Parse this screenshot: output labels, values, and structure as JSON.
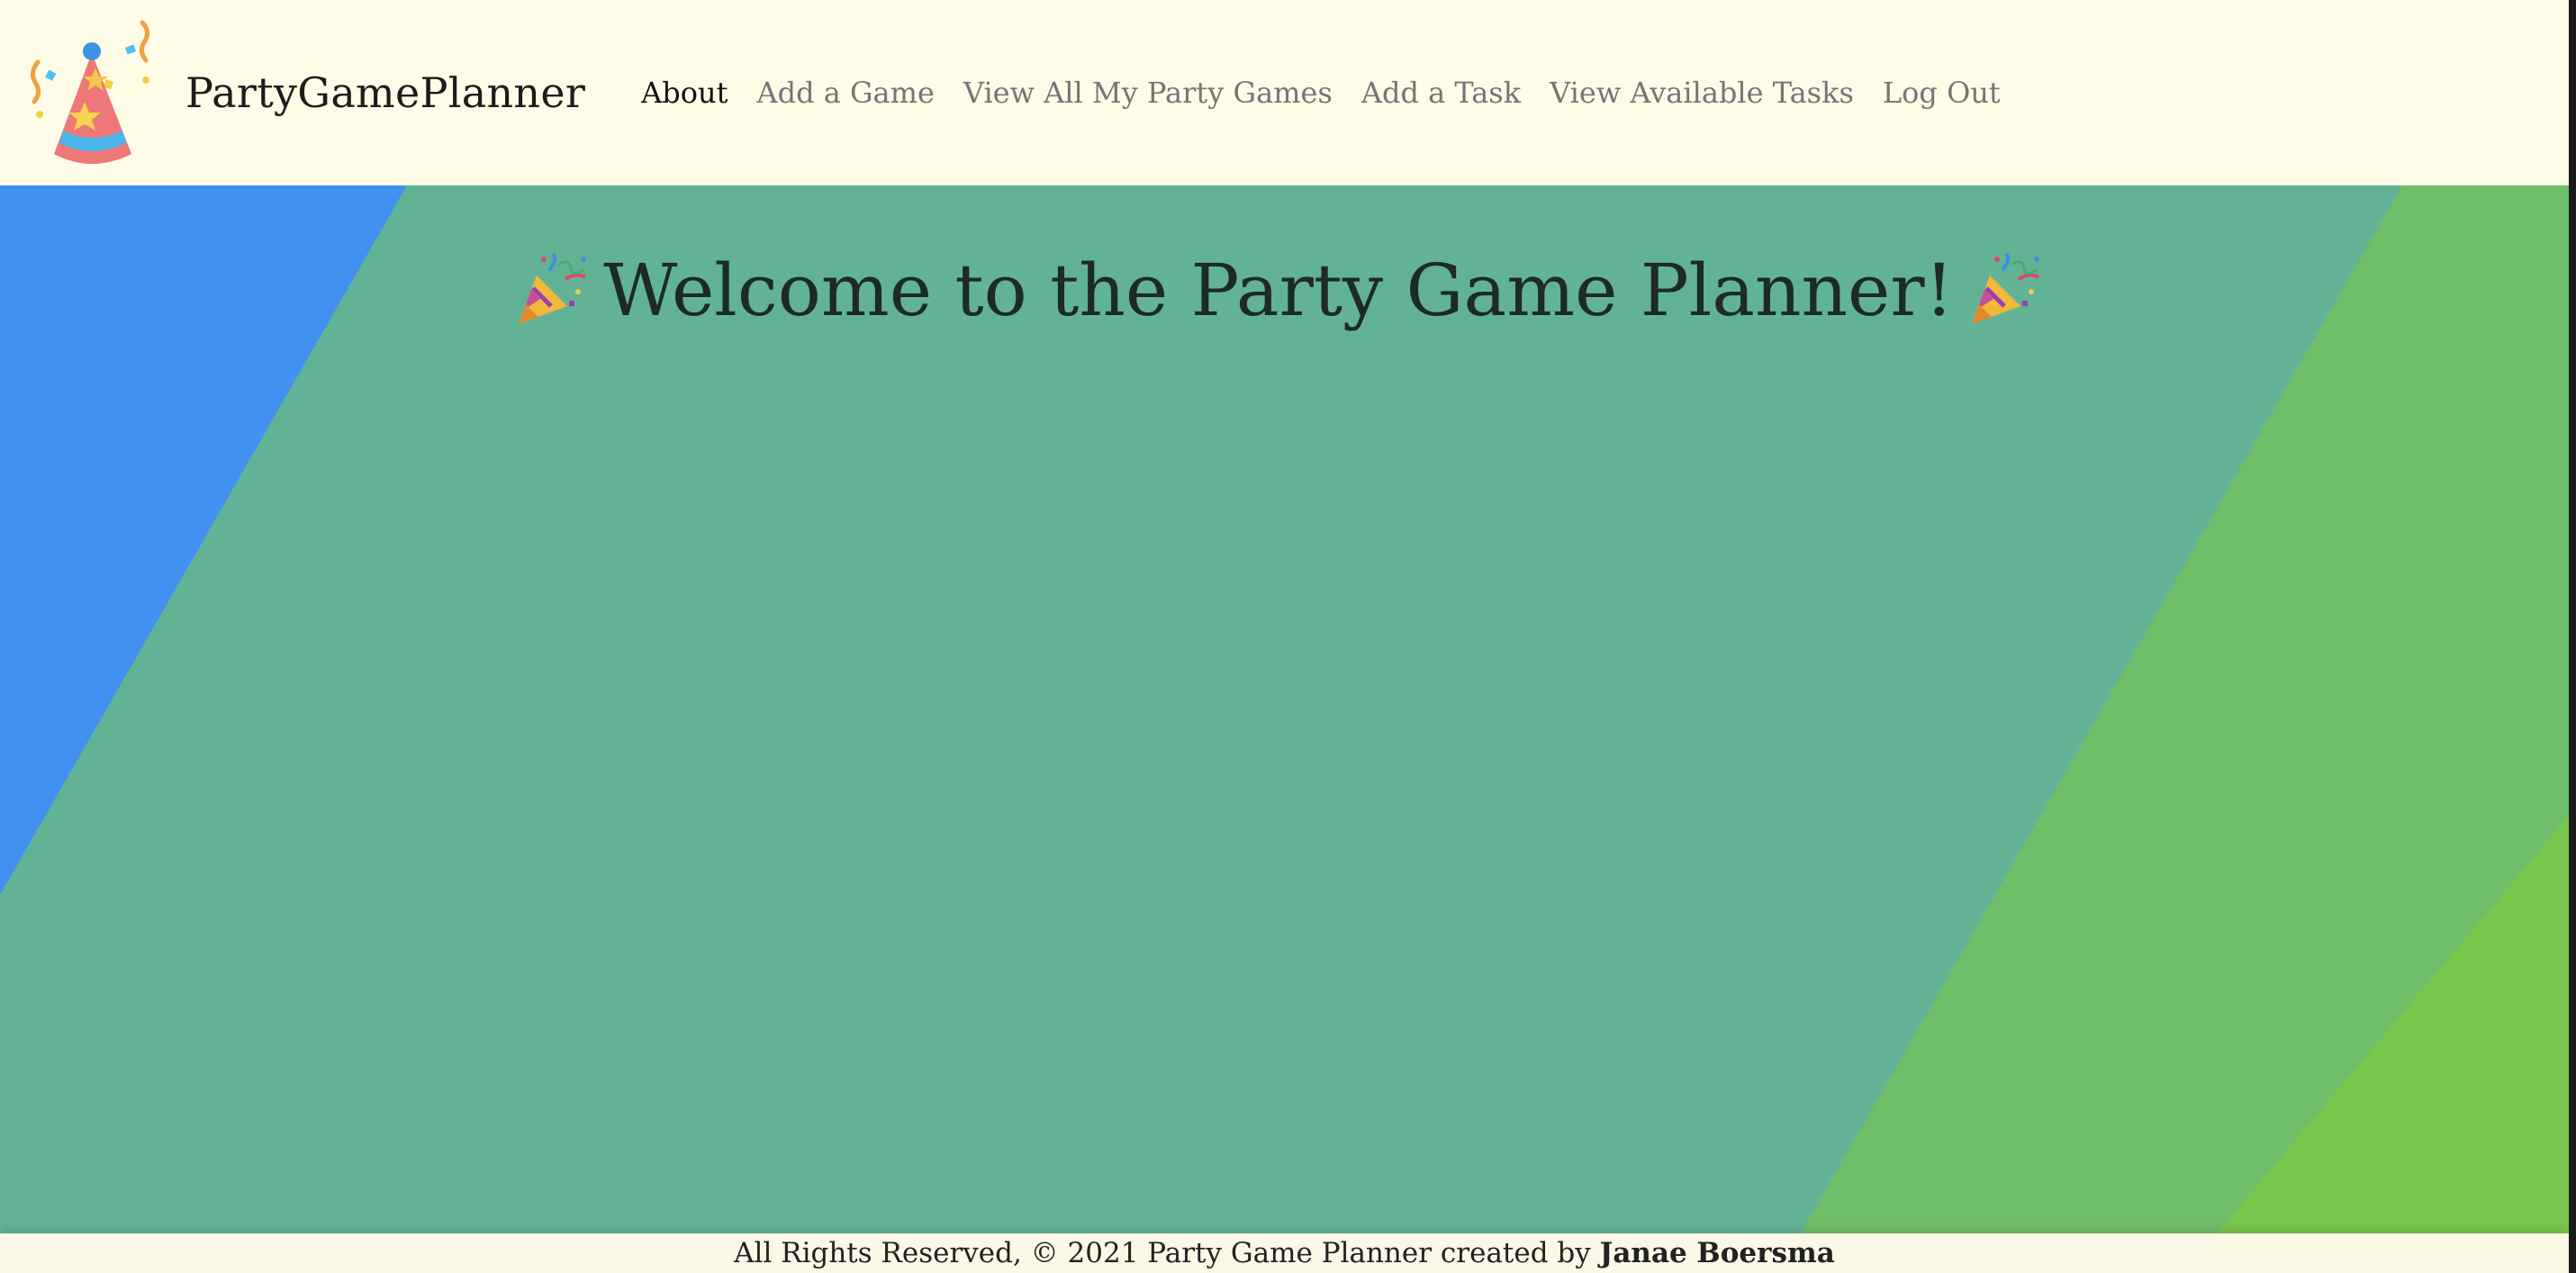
{
  "brand": {
    "name": "PartyGamePlanner",
    "logo_icon": "party-hat-icon"
  },
  "nav": {
    "items": [
      {
        "label": "About",
        "active": true
      },
      {
        "label": "Add a Game",
        "active": false
      },
      {
        "label": "View All My Party Games",
        "active": false
      },
      {
        "label": "Add a Task",
        "active": false
      },
      {
        "label": "View Available Tasks",
        "active": false
      },
      {
        "label": "Log Out",
        "active": false
      }
    ]
  },
  "hero": {
    "title": "Welcome to the Party Game Planner!",
    "left_icon": "party-popper-icon",
    "right_icon": "party-popper-icon"
  },
  "footer": {
    "text": "All Rights Reserved, © 2021 Party Game Planner created by",
    "author": "Janae Boersma"
  },
  "colors": {
    "navbar_bg": "#fefce6",
    "hero_blue": "#4291f0",
    "hero_teal": "#62b396",
    "hero_green": "#6fbe69",
    "hero_lime": "#79c64c",
    "nav_active": "#111111",
    "nav_inactive": "#757575"
  }
}
